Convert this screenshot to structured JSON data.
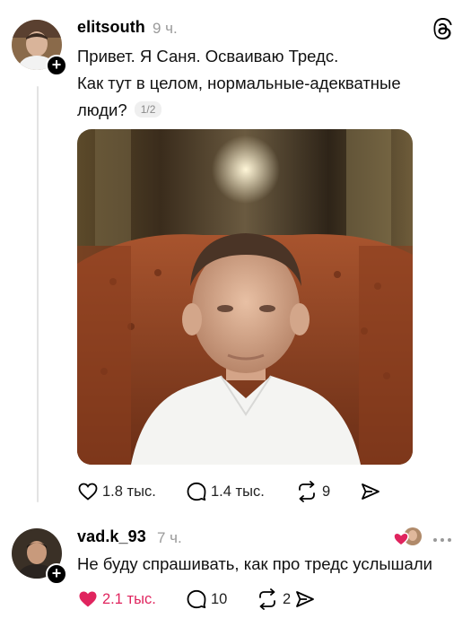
{
  "post": {
    "username": "elitsouth",
    "time": "9 ч.",
    "line1": "Привет. Я Саня. Осваиваю Тредс.",
    "line2": "Как тут в целом, нормальные-адекватные",
    "line3": "люди?",
    "page_indicator": "1/2",
    "likes": "1.8 тыс.",
    "comments": "1.4 тыс.",
    "reposts": "9"
  },
  "reply": {
    "username": "vad.k_93",
    "time": "7 ч.",
    "text": "Не буду спрашивать, как про тредс услышали",
    "likes": "2.1 тыс.",
    "comments": "10",
    "reposts": "2"
  },
  "icons": [
    "threads-logo-icon",
    "follow-plus-icon",
    "heart-icon",
    "comment-icon",
    "repost-icon",
    "share-icon",
    "more-icon"
  ],
  "colors": {
    "like_active": "#e0245e",
    "muted": "#9a9a9a",
    "thread_line": "#e3e3e3"
  }
}
